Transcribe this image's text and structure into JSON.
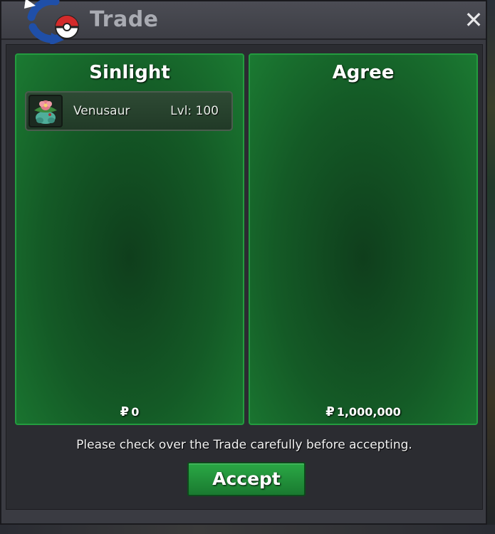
{
  "window": {
    "title": "Trade",
    "close_icon": "close-icon"
  },
  "trade": {
    "left": {
      "name": "Sinlight",
      "currency_symbol": "₽",
      "money": "0",
      "pokemon": [
        {
          "name": "Venusaur",
          "level": "Lvl: 100",
          "icon": "venusaur-sprite-icon"
        }
      ]
    },
    "right": {
      "name": "Agree",
      "currency_symbol": "₽",
      "money": "1,000,000",
      "pokemon": []
    }
  },
  "footer": {
    "notice": "Please check over the Trade carefully before accepting.",
    "accept_label": "Accept"
  },
  "colors": {
    "panel_green": "#145a26",
    "panel_border": "#239c3f",
    "accept_green": "#2aa845"
  }
}
